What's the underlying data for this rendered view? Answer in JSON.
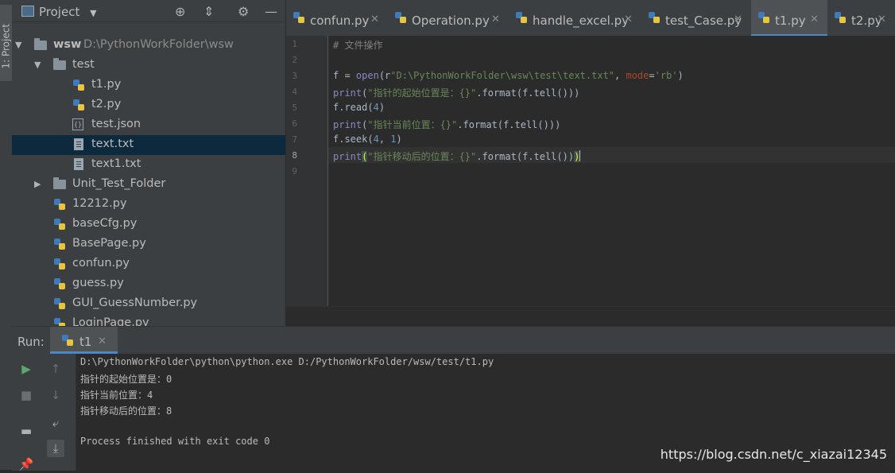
{
  "left_strip": {
    "vertical_tab": "1: Project"
  },
  "project_panel": {
    "title": "Project",
    "tree": [
      {
        "label": "wsw",
        "path": "D:\\PythonWorkFolder\\wsw",
        "type": "folder",
        "expanded": true
      },
      {
        "label": "test",
        "type": "folder",
        "expanded": true
      },
      {
        "label": "t1.py",
        "type": "py"
      },
      {
        "label": "t2.py",
        "type": "py"
      },
      {
        "label": "test.json",
        "type": "json"
      },
      {
        "label": "text.txt",
        "type": "txt",
        "selected": true
      },
      {
        "label": "text1.txt",
        "type": "txt"
      },
      {
        "label": "Unit_Test_Folder",
        "type": "folder",
        "expanded": false
      },
      {
        "label": "12212.py",
        "type": "py"
      },
      {
        "label": "baseCfg.py",
        "type": "py"
      },
      {
        "label": "BasePage.py",
        "type": "py"
      },
      {
        "label": "confun.py",
        "type": "py"
      },
      {
        "label": "guess.py",
        "type": "py"
      },
      {
        "label": "GUI_GuessNumber.py",
        "type": "py"
      },
      {
        "label": "LoginPage.py",
        "type": "py"
      }
    ]
  },
  "editor_tabs": [
    {
      "label": "confun.py",
      "active": false
    },
    {
      "label": "Operation.py",
      "active": false
    },
    {
      "label": "handle_excel.py",
      "active": false
    },
    {
      "label": "test_Case.py",
      "active": false
    },
    {
      "label": "t1.py",
      "active": true
    },
    {
      "label": "t2.py",
      "active": false
    }
  ],
  "editor": {
    "line_numbers": [
      "1",
      "2",
      "3",
      "4",
      "5",
      "6",
      "7",
      "8",
      "9"
    ],
    "current_line": 8,
    "lines": {
      "l1": {
        "comment": "# 文件操作"
      },
      "l3": {
        "a": "f = ",
        "b": "open",
        "c": "(r",
        "d": "\"D:\\PythonWorkFolder\\wsw\\test\\text.txt\"",
        "e": ", ",
        "f": "mode",
        "g": "=",
        "h": "'rb'",
        "i": ")"
      },
      "l4": {
        "a": "print",
        "b": "(",
        "c": "\"指针的起始位置是：{}\"",
        "d": ".format(f.tell()))"
      },
      "l5": {
        "a": "f.read(",
        "b": "4",
        "c": ")"
      },
      "l6": {
        "a": "print",
        "b": "(",
        "c": "\"指针当前位置：{}\"",
        "d": ".format(f.tell()))"
      },
      "l7": {
        "a": "f.seek(",
        "b": "4",
        "c": ", ",
        "d": "1",
        "e": ")"
      },
      "l8": {
        "a": "print",
        "b": "(",
        "c": "\"指针移动后的位置：{}\"",
        "d": ".format(f.tell())",
        "e": ")"
      }
    }
  },
  "run_panel": {
    "label": "Run:",
    "tab": "t1",
    "console": [
      "D:\\PythonWorkFolder\\python\\python.exe D:/PythonWorkFolder/wsw/test/t1.py",
      "指针的起始位置是：0",
      "指针当前位置：4",
      "指针移动后的位置：8",
      "",
      "Process finished with exit code 0"
    ]
  },
  "watermark": "https://blog.csdn.net/c_xiazai12345",
  "colors": {
    "accent": "#4a88c7",
    "selection": "#0d293e",
    "keyword": "#8888c6",
    "string": "#6a8759",
    "number": "#6897bb"
  }
}
